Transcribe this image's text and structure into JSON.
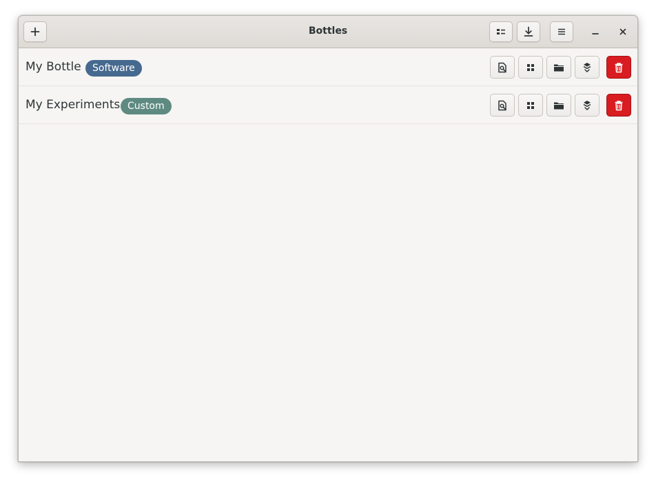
{
  "window": {
    "title": "Bottles"
  },
  "header": {
    "buttons": [
      {
        "name": "add-bottle-button",
        "icon": "plus-icon"
      },
      {
        "name": "view-mode-button",
        "icon": "list-view-icon"
      },
      {
        "name": "downloads-button",
        "icon": "download-icon"
      },
      {
        "name": "main-menu-button",
        "icon": "hamburger-menu-icon"
      },
      {
        "name": "minimize-button",
        "icon": "minimize-icon"
      },
      {
        "name": "close-button",
        "icon": "close-icon"
      }
    ]
  },
  "bottles": [
    {
      "name": "My Bottle",
      "environment": "Software",
      "badge_color": "#46698f"
    },
    {
      "name": "My Experiments",
      "environment": "Custom",
      "badge_color": "#5e8a82"
    }
  ],
  "row_actions": [
    {
      "name": "run-executable-button",
      "icon": "run-file-icon"
    },
    {
      "name": "programs-button",
      "icon": "grid-icon"
    },
    {
      "name": "browse-files-button",
      "icon": "folder-icon"
    },
    {
      "name": "dependencies-button",
      "icon": "package-icon"
    },
    {
      "name": "delete-bottle-button",
      "icon": "trash-icon"
    }
  ],
  "colors": {
    "danger": "#d91c21",
    "text": "#2e3436",
    "background": "#f6f5f4"
  }
}
